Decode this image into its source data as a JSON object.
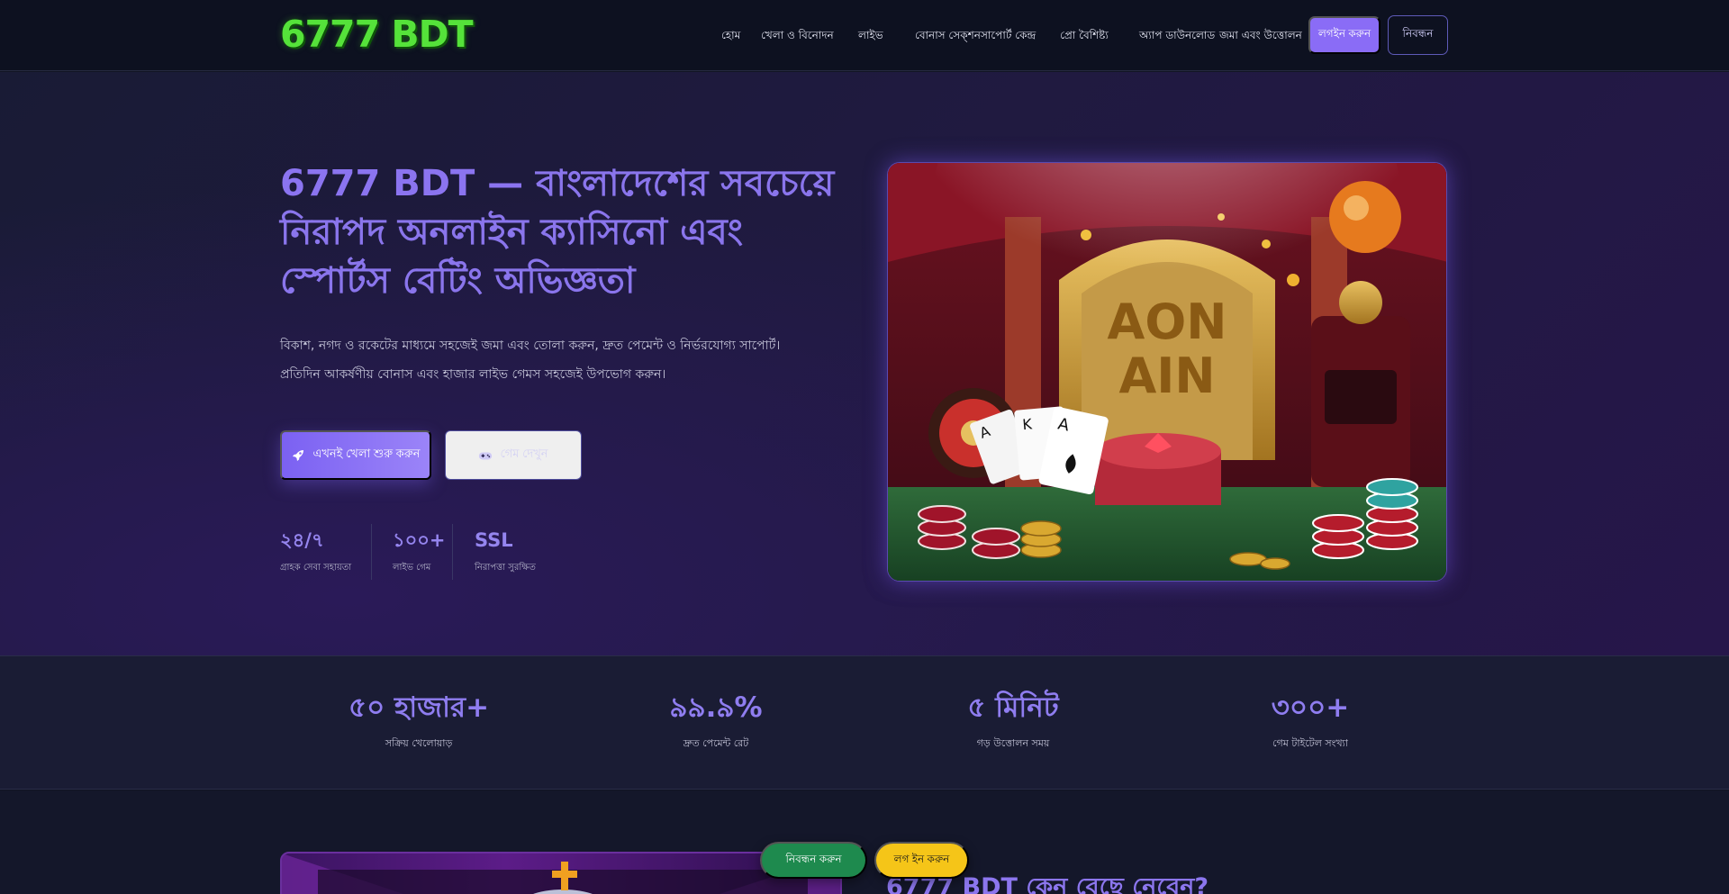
{
  "brand": {
    "logo_text": "6777 BDT",
    "logo_color": "#55e23a",
    "accent": "#8a6cf6"
  },
  "nav": {
    "links": [
      "হোম",
      "খেলা ও বিনোদন",
      "লাইভ",
      "বোনাস সেক্শন",
      "সাপোর্ট কেন্দ্র",
      "প্রো বৈশিষ্ট্য",
      "অ্যাপ ডাউনলোড",
      "জমা এবং উত্তোলন"
    ],
    "login_label": "লগইন করুন",
    "register_label": "নিবন্ধন"
  },
  "hero": {
    "title_brand": "6777 BDT —",
    "title_rest": "বাংলাদেশের সবচেয়ে নিরাপদ অনলাইন ক্যাসিনো এবং স্পোর্টস বেটিং অভিজ্ঞতা",
    "description": "বিকাশ, নগদ ও রকেটের মাধ্যমে সহজেই জমা এবং তোলা করুন, দ্রুত পেমেন্ট ও নির্ভরযোগ্য সাপোর্ট। প্রতিদিন আকর্ষণীয় বোনাস এবং হাজার লাইভ গেমস সহজেই উপভোগ করুন।",
    "primary_cta": "এখনই খেলা শুরু করুন",
    "primary_icon": "rocket-icon",
    "secondary_cta": "গেম দেখুন",
    "secondary_icon": "gamepad-icon",
    "mini_stats": [
      {
        "value": "২৪/৭",
        "label": "গ্রাহক সেবা সহায়তা"
      },
      {
        "value": "১০০+",
        "label": "লাইভ গেম"
      },
      {
        "value": "SSL",
        "label": "নিরাপত্তা সুরক্ষিত"
      }
    ]
  },
  "stats_band": [
    {
      "value": "৫০ হাজার+",
      "label": "সক্রিয় খেলোয়াড়"
    },
    {
      "value": "৯৯.৯%",
      "label": "দ্রুত পেমেন্ট রেট"
    },
    {
      "value": "৫ মিনিট",
      "label": "গড় উত্তোলন সময়"
    },
    {
      "value": "৩০০+",
      "label": "গেম টাইটেল সংখ্যা"
    }
  ],
  "lower": {
    "title": "6777 BDT কেন বেছে নেবেন?"
  },
  "floating": {
    "primary_label": "নিবন্ধন করুন",
    "secondary_label": "লগ ইন করুন"
  }
}
